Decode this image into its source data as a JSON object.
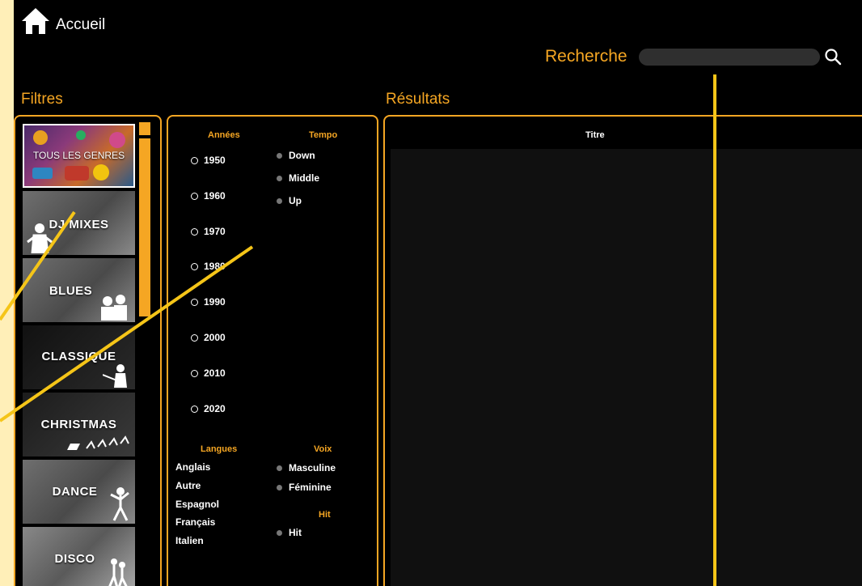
{
  "header": {
    "home_label": "Accueil"
  },
  "search": {
    "label": "Recherche",
    "value": "",
    "placeholder": ""
  },
  "filters": {
    "title": "Filtres",
    "genres": [
      "TOUS LES GENRES",
      "DJ MIXES",
      "BLUES",
      "CLASSIQUE",
      "CHRISTMAS",
      "DANCE",
      "DISCO"
    ],
    "years": {
      "heading": "Années",
      "options": [
        "1950",
        "1960",
        "1970",
        "1980",
        "1990",
        "2000",
        "2010",
        "2020"
      ]
    },
    "tempo": {
      "heading": "Tempo",
      "options": [
        "Down",
        "Middle",
        "Up"
      ]
    },
    "languages": {
      "heading": "Langues",
      "options": [
        "Anglais",
        "Autre",
        "Espagnol",
        "Français",
        "Italien"
      ]
    },
    "voice": {
      "heading": "Voix",
      "options": [
        "Masculine",
        "Féminine"
      ]
    },
    "hit": {
      "heading": "Hit",
      "options": [
        "Hit"
      ]
    }
  },
  "results": {
    "title": "Résultats",
    "columns": [
      "Titre"
    ]
  },
  "colors": {
    "accent": "#f5a623",
    "background": "#000000",
    "page": "#ffefb8"
  }
}
